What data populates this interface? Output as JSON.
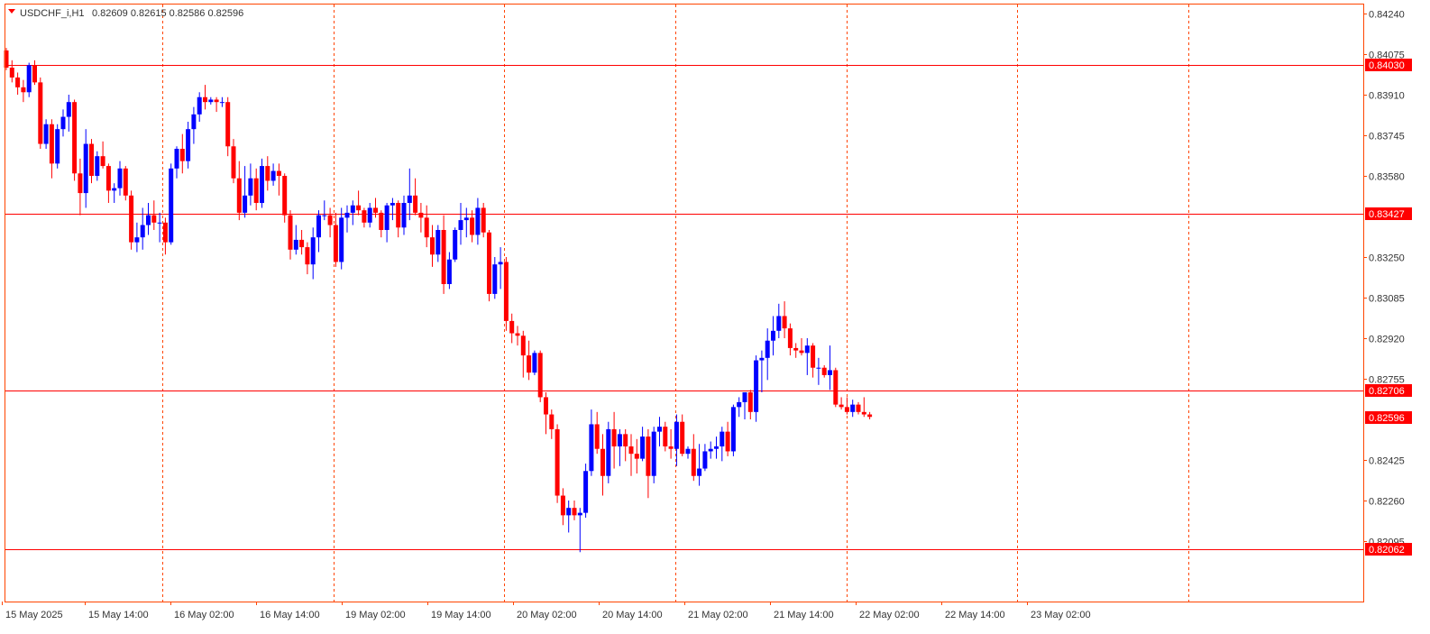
{
  "header": {
    "symbol": "USDCHF_i,H1",
    "ohlc": "0.82609 0.82615 0.82586 0.82596"
  },
  "colors": {
    "bull": "#0000ff",
    "bear": "#ff0000",
    "accent": "#ff0000",
    "axis": "#ff4500",
    "grid": "#ff4500",
    "frame": "#ff4500",
    "price_badge": "#ff0000"
  },
  "chart_data": {
    "type": "candlestick",
    "title": "",
    "ylim": [
      0.8206,
      0.8424
    ],
    "y_ticks": [
      0.8424,
      0.84075,
      0.8391,
      0.83745,
      0.8358,
      0.8325,
      0.83085,
      0.8292,
      0.82755,
      0.82425,
      0.8226,
      0.82095
    ],
    "y_tick_labels": [
      "0.84240",
      "0.84075",
      "0.83910",
      "0.83745",
      "0.83580",
      "0.83250",
      "0.83085",
      "0.82920",
      "0.82755",
      "0.82425",
      "0.82260",
      "0.82095"
    ],
    "horizontal_levels": [
      {
        "value": 0.8403,
        "label": "0.84030"
      },
      {
        "value": 0.83427,
        "label": "0.83427"
      },
      {
        "value": 0.82706,
        "label": "0.82706"
      },
      {
        "value": 0.82062,
        "label": "0.82062"
      }
    ],
    "current_price": {
      "value": 0.82596,
      "label": "0.82596"
    },
    "x_labels": [
      "15 May 2025",
      "15 May 14:00",
      "16 May 02:00",
      "16 May 14:00",
      "19 May 02:00",
      "19 May 14:00",
      "20 May 02:00",
      "20 May 14:00",
      "21 May 02:00",
      "21 May 14:00",
      "22 May 02:00",
      "22 May 14:00",
      "23 May 02:00"
    ],
    "day_separators": [
      "16 May",
      "19 May",
      "20 May",
      "21 May",
      "22 May",
      "23 May",
      "26 May"
    ],
    "candles": [
      [
        0.8409,
        0.841,
        0.8401,
        0.8402
      ],
      [
        0.8402,
        0.8405,
        0.8396,
        0.8398
      ],
      [
        0.8398,
        0.84,
        0.8391,
        0.8394
      ],
      [
        0.8394,
        0.8397,
        0.8388,
        0.8392
      ],
      [
        0.8392,
        0.8404,
        0.839,
        0.8403
      ],
      [
        0.8403,
        0.8405,
        0.8395,
        0.8396
      ],
      [
        0.8396,
        0.8398,
        0.8369,
        0.8371
      ],
      [
        0.8371,
        0.8381,
        0.8369,
        0.8379
      ],
      [
        0.8379,
        0.8381,
        0.8357,
        0.8363
      ],
      [
        0.8363,
        0.8379,
        0.8361,
        0.8377
      ],
      [
        0.8377,
        0.8385,
        0.8374,
        0.8382
      ],
      [
        0.8382,
        0.8391,
        0.8376,
        0.8388
      ],
      [
        0.8388,
        0.8389,
        0.8356,
        0.8359
      ],
      [
        0.8359,
        0.8365,
        0.8342,
        0.8351
      ],
      [
        0.8351,
        0.8377,
        0.8345,
        0.8371
      ],
      [
        0.8371,
        0.8373,
        0.8355,
        0.8358
      ],
      [
        0.8358,
        0.8368,
        0.8356,
        0.8366
      ],
      [
        0.8366,
        0.8372,
        0.8361,
        0.8362
      ],
      [
        0.8362,
        0.8363,
        0.8347,
        0.8352
      ],
      [
        0.8352,
        0.8355,
        0.8347,
        0.8353
      ],
      [
        0.8353,
        0.8364,
        0.835,
        0.8361
      ],
      [
        0.8361,
        0.8362,
        0.8348,
        0.835
      ],
      [
        0.835,
        0.8352,
        0.8328,
        0.8331
      ],
      [
        0.8331,
        0.8339,
        0.8327,
        0.8333
      ],
      [
        0.8333,
        0.8345,
        0.8328,
        0.8338
      ],
      [
        0.8338,
        0.8347,
        0.8334,
        0.8342
      ],
      [
        0.8342,
        0.8348,
        0.8336,
        0.8339
      ],
      [
        0.8339,
        0.8343,
        0.8331,
        0.8339
      ],
      [
        0.8339,
        0.8341,
        0.8326,
        0.8331
      ],
      [
        0.8331,
        0.8363,
        0.833,
        0.8361
      ],
      [
        0.8361,
        0.837,
        0.8357,
        0.8369
      ],
      [
        0.8369,
        0.8375,
        0.8359,
        0.8364
      ],
      [
        0.8364,
        0.838,
        0.8361,
        0.8377
      ],
      [
        0.8377,
        0.8386,
        0.8371,
        0.8383
      ],
      [
        0.8383,
        0.8392,
        0.838,
        0.839
      ],
      [
        0.839,
        0.8395,
        0.8385,
        0.8388
      ],
      [
        0.8388,
        0.839,
        0.8387,
        0.8389
      ],
      [
        0.8389,
        0.839,
        0.8384,
        0.8388
      ],
      [
        0.8388,
        0.839,
        0.8386,
        0.8388
      ],
      [
        0.8388,
        0.839,
        0.8366,
        0.837
      ],
      [
        0.837,
        0.8373,
        0.8355,
        0.8357
      ],
      [
        0.8357,
        0.8364,
        0.834,
        0.8343
      ],
      [
        0.8343,
        0.8362,
        0.8341,
        0.835
      ],
      [
        0.835,
        0.8363,
        0.8346,
        0.8357
      ],
      [
        0.8357,
        0.8361,
        0.8344,
        0.8347
      ],
      [
        0.8347,
        0.8365,
        0.8345,
        0.8362
      ],
      [
        0.8362,
        0.8366,
        0.8352,
        0.8356
      ],
      [
        0.8356,
        0.8363,
        0.8354,
        0.836
      ],
      [
        0.836,
        0.8363,
        0.835,
        0.8358
      ],
      [
        0.8358,
        0.8359,
        0.8339,
        0.8342
      ],
      [
        0.8342,
        0.8344,
        0.8324,
        0.8328
      ],
      [
        0.8328,
        0.8338,
        0.8326,
        0.8332
      ],
      [
        0.8332,
        0.8336,
        0.8326,
        0.8329
      ],
      [
        0.8329,
        0.8331,
        0.8318,
        0.8322
      ],
      [
        0.8322,
        0.8337,
        0.8316,
        0.8333
      ],
      [
        0.8333,
        0.8344,
        0.8327,
        0.8342
      ],
      [
        0.8342,
        0.8348,
        0.834,
        0.8342
      ],
      [
        0.8342,
        0.8345,
        0.8333,
        0.8338
      ],
      [
        0.8338,
        0.8343,
        0.8321,
        0.8323
      ],
      [
        0.8323,
        0.8345,
        0.832,
        0.8341
      ],
      [
        0.8341,
        0.8346,
        0.8335,
        0.8343
      ],
      [
        0.8343,
        0.8348,
        0.8338,
        0.8346
      ],
      [
        0.8346,
        0.8352,
        0.8342,
        0.8344
      ],
      [
        0.8344,
        0.8345,
        0.8337,
        0.8339
      ],
      [
        0.8339,
        0.8347,
        0.8337,
        0.8345
      ],
      [
        0.8345,
        0.8349,
        0.8341,
        0.8343
      ],
      [
        0.8343,
        0.8344,
        0.8333,
        0.8336
      ],
      [
        0.8336,
        0.8347,
        0.8331,
        0.8346
      ],
      [
        0.8346,
        0.8349,
        0.834,
        0.8347
      ],
      [
        0.8347,
        0.8348,
        0.8333,
        0.8337
      ],
      [
        0.8337,
        0.835,
        0.8334,
        0.8347
      ],
      [
        0.8347,
        0.8361,
        0.834,
        0.835
      ],
      [
        0.835,
        0.8357,
        0.8342,
        0.8343
      ],
      [
        0.8343,
        0.8347,
        0.8335,
        0.8341
      ],
      [
        0.8341,
        0.8346,
        0.8329,
        0.8333
      ],
      [
        0.8333,
        0.8338,
        0.8321,
        0.8326
      ],
      [
        0.8326,
        0.8338,
        0.8323,
        0.8336
      ],
      [
        0.8336,
        0.8342,
        0.831,
        0.8314
      ],
      [
        0.8314,
        0.8327,
        0.8312,
        0.8324
      ],
      [
        0.8324,
        0.8337,
        0.8323,
        0.8336
      ],
      [
        0.8336,
        0.8347,
        0.833,
        0.834
      ],
      [
        0.834,
        0.8345,
        0.8333,
        0.8341
      ],
      [
        0.8341,
        0.8344,
        0.8331,
        0.8334
      ],
      [
        0.8334,
        0.8349,
        0.833,
        0.8345
      ],
      [
        0.8345,
        0.8347,
        0.8333,
        0.8335
      ],
      [
        0.8335,
        0.8336,
        0.8307,
        0.831
      ],
      [
        0.831,
        0.8325,
        0.8308,
        0.8322
      ],
      [
        0.8322,
        0.8329,
        0.8312,
        0.8323
      ],
      [
        0.8323,
        0.8325,
        0.8295,
        0.8299
      ],
      [
        0.8299,
        0.8302,
        0.829,
        0.8294
      ],
      [
        0.8294,
        0.8297,
        0.8289,
        0.8293
      ],
      [
        0.8293,
        0.8295,
        0.8276,
        0.8285
      ],
      [
        0.8285,
        0.8291,
        0.8275,
        0.8278
      ],
      [
        0.8278,
        0.8287,
        0.8277,
        0.8286
      ],
      [
        0.8286,
        0.8287,
        0.8266,
        0.8268
      ],
      [
        0.8268,
        0.827,
        0.8253,
        0.8261
      ],
      [
        0.8261,
        0.8263,
        0.8251,
        0.8255
      ],
      [
        0.8255,
        0.8257,
        0.8225,
        0.8228
      ],
      [
        0.8228,
        0.8231,
        0.8216,
        0.822
      ],
      [
        0.822,
        0.8226,
        0.8213,
        0.8223
      ],
      [
        0.8223,
        0.8226,
        0.8218,
        0.822
      ],
      [
        0.822,
        0.8223,
        0.8205,
        0.8221
      ],
      [
        0.8221,
        0.8241,
        0.8219,
        0.8238
      ],
      [
        0.8238,
        0.8263,
        0.8236,
        0.8257
      ],
      [
        0.8257,
        0.8262,
        0.8245,
        0.8247
      ],
      [
        0.8247,
        0.8253,
        0.8228,
        0.8236
      ],
      [
        0.8236,
        0.8258,
        0.8233,
        0.8255
      ],
      [
        0.8255,
        0.8262,
        0.8239,
        0.8248
      ],
      [
        0.8248,
        0.8255,
        0.824,
        0.8253
      ],
      [
        0.8253,
        0.8255,
        0.8242,
        0.8248
      ],
      [
        0.8248,
        0.8253,
        0.8236,
        0.8245
      ],
      [
        0.8245,
        0.8251,
        0.8237,
        0.8243
      ],
      [
        0.8243,
        0.8256,
        0.8242,
        0.8252
      ],
      [
        0.8252,
        0.8255,
        0.8227,
        0.8236
      ],
      [
        0.8236,
        0.8256,
        0.8233,
        0.8254
      ],
      [
        0.8254,
        0.826,
        0.8248,
        0.8256
      ],
      [
        0.8256,
        0.8258,
        0.8246,
        0.8248
      ],
      [
        0.8248,
        0.8255,
        0.8243,
        0.8247
      ],
      [
        0.8247,
        0.8261,
        0.824,
        0.8258
      ],
      [
        0.8258,
        0.8261,
        0.8244,
        0.8245
      ],
      [
        0.8245,
        0.8248,
        0.8243,
        0.8247
      ],
      [
        0.8247,
        0.8253,
        0.8234,
        0.8236
      ],
      [
        0.8236,
        0.8249,
        0.8232,
        0.8239
      ],
      [
        0.8239,
        0.8249,
        0.8238,
        0.8246
      ],
      [
        0.8246,
        0.825,
        0.8243,
        0.8247
      ],
      [
        0.8247,
        0.8252,
        0.8243,
        0.8248
      ],
      [
        0.8248,
        0.8256,
        0.8242,
        0.8254
      ],
      [
        0.8254,
        0.8258,
        0.8244,
        0.8246
      ],
      [
        0.8246,
        0.8265,
        0.8244,
        0.8264
      ],
      [
        0.8264,
        0.8268,
        0.826,
        0.8266
      ],
      [
        0.8266,
        0.827,
        0.8259,
        0.827
      ],
      [
        0.827,
        0.8271,
        0.8259,
        0.8262
      ],
      [
        0.8262,
        0.8285,
        0.8258,
        0.8283
      ],
      [
        0.8283,
        0.8287,
        0.827,
        0.8284
      ],
      [
        0.8284,
        0.8296,
        0.8275,
        0.8291
      ],
      [
        0.8291,
        0.8301,
        0.8285,
        0.8295
      ],
      [
        0.8295,
        0.8306,
        0.8292,
        0.8301
      ],
      [
        0.8301,
        0.8307,
        0.8292,
        0.8296
      ],
      [
        0.8296,
        0.8298,
        0.8285,
        0.8288
      ],
      [
        0.8288,
        0.829,
        0.8284,
        0.8287
      ],
      [
        0.8287,
        0.8292,
        0.8285,
        0.8286
      ],
      [
        0.8286,
        0.8292,
        0.8277,
        0.8289
      ],
      [
        0.8289,
        0.829,
        0.8276,
        0.828
      ],
      [
        0.828,
        0.8284,
        0.8273,
        0.828
      ],
      [
        0.828,
        0.8281,
        0.8276,
        0.8277
      ],
      [
        0.8277,
        0.8289,
        0.8271,
        0.8279
      ],
      [
        0.8279,
        0.828,
        0.8264,
        0.8265
      ],
      [
        0.8265,
        0.8268,
        0.8263,
        0.8264
      ],
      [
        0.8264,
        0.8268,
        0.8261,
        0.8262
      ],
      [
        0.8262,
        0.8267,
        0.826,
        0.8265
      ],
      [
        0.8265,
        0.8266,
        0.8261,
        0.8262
      ],
      [
        0.8262,
        0.8268,
        0.826,
        0.8261
      ],
      [
        0.8261,
        0.8262,
        0.8259,
        0.826
      ]
    ]
  }
}
